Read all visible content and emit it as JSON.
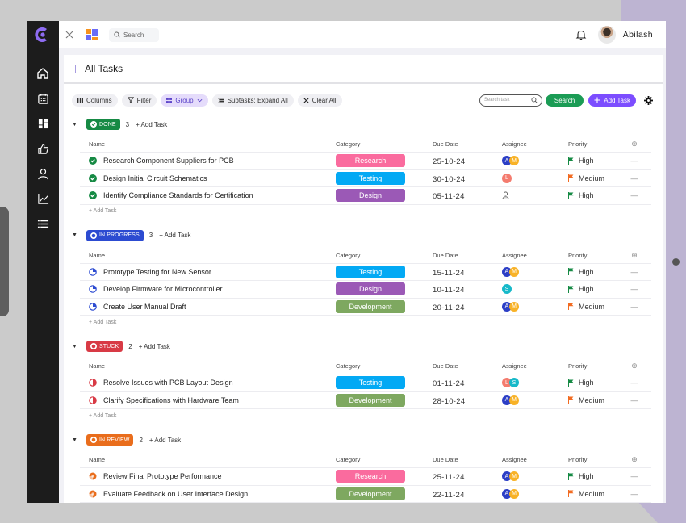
{
  "app": {
    "top_search_placeholder": "Search",
    "user_name": "Abilash"
  },
  "page": {
    "title": "All Tasks"
  },
  "toolbar": {
    "columns": "Columns",
    "filter": "Filter",
    "group": "Group",
    "subtasks": "Subtasks: Expand All",
    "clear_all": "Clear All",
    "task_search_placeholder": "Search task",
    "search_button": "Search",
    "add_task_button": "Add Task"
  },
  "columns": {
    "name": "Name",
    "category": "Category",
    "due_date": "Due Date",
    "assignee": "Assignee",
    "priority": "Priority"
  },
  "add_task_label": "+ Add Task",
  "colors": {
    "done": "#168a44",
    "in_progress": "#2c4bd1",
    "stuck": "#d83a45",
    "in_review": "#e96d1c",
    "Research": "#fa6b9e",
    "Testing": "#03a9f4",
    "Design": "#9b59b6",
    "Development": "#7ea860",
    "High": "#168a44",
    "Medium": "#f26b21",
    "avatar_A": "#2c3fc6",
    "avatar_M": "#f8b227",
    "avatar_L": "#f47c6f",
    "avatar_S": "#17b9c9"
  },
  "groups": [
    {
      "status": "DONE",
      "key": "done",
      "count": "3",
      "tasks": [
        {
          "name": "Research Component Suppliers for PCB",
          "category": "Research",
          "due": "25-10-24",
          "assignees": [
            "A",
            "M"
          ],
          "priority": "High"
        },
        {
          "name": "Design Initial Circuit Schematics",
          "category": "Testing",
          "due": "30-10-24",
          "assignees": [
            "L"
          ],
          "priority": "Medium"
        },
        {
          "name": "Identify Compliance Standards for Certification",
          "category": "Design",
          "due": "05-11-24",
          "assignees": [],
          "priority": "High"
        }
      ]
    },
    {
      "status": "IN PROGRESS",
      "key": "in_progress",
      "count": "3",
      "tasks": [
        {
          "name": "Prototype Testing for New Sensor",
          "category": "Testing",
          "due": "15-11-24",
          "assignees": [
            "A",
            "M"
          ],
          "priority": "High"
        },
        {
          "name": "Develop Firmware for Microcontroller",
          "category": "Design",
          "due": "10-11-24",
          "assignees": [
            "S"
          ],
          "priority": "High"
        },
        {
          "name": "Create User Manual Draft",
          "category": "Development",
          "due": "20-11-24",
          "assignees": [
            "A",
            "M"
          ],
          "priority": "Medium"
        }
      ]
    },
    {
      "status": "STUCK",
      "key": "stuck",
      "count": "2",
      "tasks": [
        {
          "name": "Resolve Issues with PCB Layout Design",
          "category": "Testing",
          "due": "01-11-24",
          "assignees": [
            "L",
            "S"
          ],
          "priority": "High"
        },
        {
          "name": "Clarify Specifications with Hardware Team",
          "category": "Development",
          "due": "28-10-24",
          "assignees": [
            "A",
            "M"
          ],
          "priority": "Medium"
        }
      ]
    },
    {
      "status": "IN REVIEW",
      "key": "in_review",
      "count": "2",
      "tasks": [
        {
          "name": "Review Final Prototype Performance",
          "category": "Research",
          "due": "25-11-24",
          "assignees": [
            "A",
            "M"
          ],
          "priority": "High"
        },
        {
          "name": "Evaluate Feedback on User Interface Design",
          "category": "Development",
          "due": "22-11-24",
          "assignees": [
            "A",
            "M"
          ],
          "priority": "Medium"
        }
      ]
    }
  ]
}
